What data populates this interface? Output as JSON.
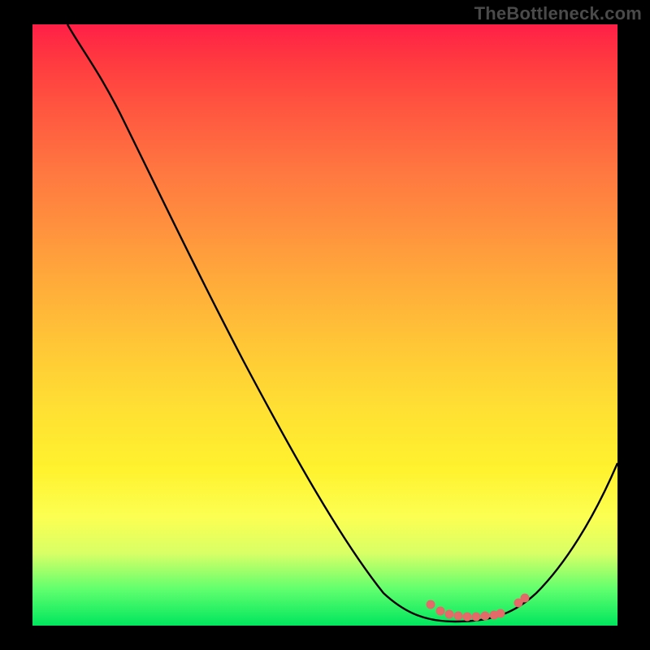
{
  "watermark": "TheBottleneck.com",
  "chart_data": {
    "type": "line",
    "title": "",
    "xlabel": "",
    "ylabel": "",
    "xlim": [
      0,
      100
    ],
    "ylim": [
      0,
      100
    ],
    "grid": false,
    "series": [
      {
        "name": "bottleneck-curve",
        "x": [
          6,
          10,
          15,
          20,
          25,
          30,
          35,
          40,
          45,
          50,
          55,
          60,
          64,
          68,
          72,
          76,
          80,
          84,
          88,
          92,
          96,
          100
        ],
        "values": [
          100,
          97,
          92,
          85,
          78,
          71,
          64,
          57,
          50,
          43,
          36,
          29,
          22,
          15,
          8,
          3,
          1,
          1,
          4,
          10,
          18,
          27
        ],
        "color": "#000000"
      }
    ],
    "highlight": {
      "name": "optimal-range-markers",
      "color": "#e46a6a",
      "points_x": [
        68,
        70,
        71,
        73,
        74,
        75,
        76,
        77,
        78,
        80,
        83,
        84
      ],
      "points_y": [
        3.5,
        2.5,
        2.2,
        1.8,
        1.6,
        1.5,
        1.5,
        1.5,
        1.6,
        1.8,
        3.2,
        3.8
      ]
    },
    "background_gradient": {
      "orientation": "vertical",
      "stops": [
        {
          "pos": 0,
          "color": "#ff1f47"
        },
        {
          "pos": 50,
          "color": "#ffc038"
        },
        {
          "pos": 80,
          "color": "#fcff52"
        },
        {
          "pos": 100,
          "color": "#00e65e"
        }
      ]
    }
  }
}
